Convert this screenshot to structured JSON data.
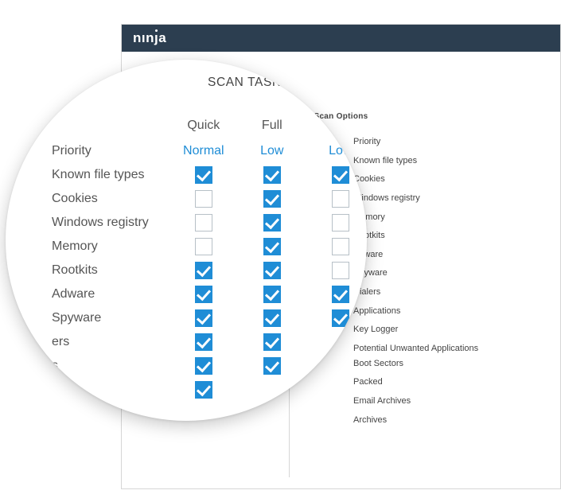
{
  "brand": "ninja",
  "window": {
    "section_title": "Scan Options",
    "labels": [
      "Priority",
      "Known file types",
      "Cookies",
      "Windows registry",
      "Memory",
      "Rootkits",
      "Adware",
      "Spyware",
      "Dialers",
      "Applications",
      "Key Logger",
      "Potential Unwanted Applications",
      "Boot Sectors",
      "Packed",
      "Email Archives",
      "Archives"
    ]
  },
  "lens": {
    "title": "SCAN TASK O",
    "columns": [
      "Quick",
      "Full",
      ""
    ],
    "priority_label": "Priority",
    "priority_values": [
      "Normal",
      "Low",
      "Low"
    ],
    "rows": [
      {
        "label": "Known file types",
        "q": true,
        "f": true,
        "c": true
      },
      {
        "label": "Cookies",
        "q": false,
        "f": true,
        "c": false
      },
      {
        "label": "Windows registry",
        "q": false,
        "f": true,
        "c": false
      },
      {
        "label": "Memory",
        "q": false,
        "f": true,
        "c": false
      },
      {
        "label": "Rootkits",
        "q": true,
        "f": true,
        "c": false
      },
      {
        "label": "Adware",
        "q": true,
        "f": true,
        "c": true
      },
      {
        "label": "Spyware",
        "q": true,
        "f": true,
        "c": true
      },
      {
        "label": "ers",
        "q": true,
        "f": true,
        "c": null
      },
      {
        "label": "s",
        "q": true,
        "f": true,
        "c": null
      },
      {
        "label": "",
        "q": true,
        "f": null,
        "c": null
      }
    ]
  }
}
